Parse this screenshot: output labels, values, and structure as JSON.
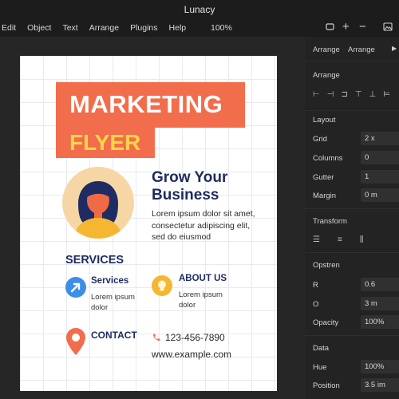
{
  "window": {
    "title": "Lunacy"
  },
  "menu": {
    "items": [
      "Edit",
      "Object",
      "Text",
      "Arrange",
      "Plugins",
      "Help"
    ],
    "zoom": "100%"
  },
  "toolbar": {
    "icons": [
      "frame-icon",
      "plus-icon",
      "minus-icon",
      "image-icon"
    ]
  },
  "flyer": {
    "headline1": "MARKETING",
    "headline2": "FLYER",
    "title": "Grow Your Business",
    "body": "Lorem ipsum dolor sit amet, consectetur adipiscing elit, sed do eiusmod",
    "services_heading": "SERVICES",
    "services": {
      "title": "Services",
      "body": "Lorem ipsum dolor"
    },
    "about": {
      "title": "ABOUT US",
      "body": "Lorem ipsum dolor"
    },
    "contact_heading": "CONTACT",
    "phone": "123-456-7890",
    "website": "www.example.com",
    "colors": {
      "accent": "#f26d4b",
      "headline2": "#ffd54a",
      "navy": "#1e2b5e",
      "blue": "#3d8ee8",
      "yellow": "#f5b731"
    }
  },
  "panel": {
    "tabs": [
      "Arrange",
      "Arrange"
    ],
    "arrange_heading": "Arrange",
    "layout_heading": "Layout",
    "layout": [
      {
        "label": "Grid",
        "value": "2 x"
      },
      {
        "label": "Columns",
        "value": "0"
      },
      {
        "label": "Gutter",
        "value": "1"
      },
      {
        "label": "Margin",
        "value": "0 m"
      }
    ],
    "transform_heading": "Transform",
    "opstren_heading": "Opstren",
    "opstren": [
      {
        "label": "R",
        "value": "0.6"
      },
      {
        "label": "O",
        "value": "3 m"
      },
      {
        "label": "Opacity",
        "value": "100%"
      }
    ],
    "data_heading": "Data",
    "data": [
      {
        "label": "Hue",
        "value": "100%"
      },
      {
        "label": "Position",
        "value": "3.5 im"
      }
    ]
  }
}
